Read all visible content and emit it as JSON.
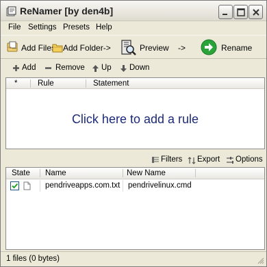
{
  "window": {
    "title": "ReNamer  [by den4b]",
    "icon": "renamer-app-icon",
    "controls": [
      "minimize-icon",
      "maximize-icon",
      "close-icon"
    ]
  },
  "menu": {
    "items": [
      {
        "label": "File"
      },
      {
        "label": "Settings"
      },
      {
        "label": "Presets"
      },
      {
        "label": "Help"
      }
    ]
  },
  "toolbar": {
    "add_files": {
      "label": "Add Files",
      "icon": "add-files-icon"
    },
    "add_folder": {
      "label": "Add Folder",
      "icon": "add-folder-icon",
      "arrow": "->"
    },
    "preview": {
      "label": "Preview",
      "icon": "preview-icon"
    },
    "separator_arrow": "->",
    "rename": {
      "label": "Rename",
      "icon": "rename-arrow-icon",
      "color": "#2aa33a"
    }
  },
  "rule_toolbar": {
    "add": {
      "label": "Add",
      "icon": "plus-icon"
    },
    "remove": {
      "label": "Remove",
      "icon": "minus-icon"
    },
    "up": {
      "label": "Up",
      "icon": "arrow-up-icon"
    },
    "down": {
      "label": "Down",
      "icon": "arrow-down-icon"
    }
  },
  "rules_table": {
    "columns": [
      "*",
      "Rule",
      "Statement"
    ],
    "empty_prompt": "Click here to add a rule",
    "empty_prompt_color": "#1c2a7a"
  },
  "files_toolbar": {
    "filters": {
      "label": "Filters",
      "icon": "filters-icon"
    },
    "export": {
      "label": "Export",
      "icon": "export-icon"
    },
    "options": {
      "label": "Options",
      "icon": "options-icon"
    }
  },
  "files_table": {
    "columns": [
      "State",
      "Name",
      "New Name"
    ],
    "rows": [
      {
        "checked": true,
        "icon": "file-icon",
        "name": "pendriveapps.com.txt",
        "new_name": "pendrivelinux.cmd"
      }
    ]
  },
  "status": {
    "text": "1 files (0 bytes)"
  }
}
